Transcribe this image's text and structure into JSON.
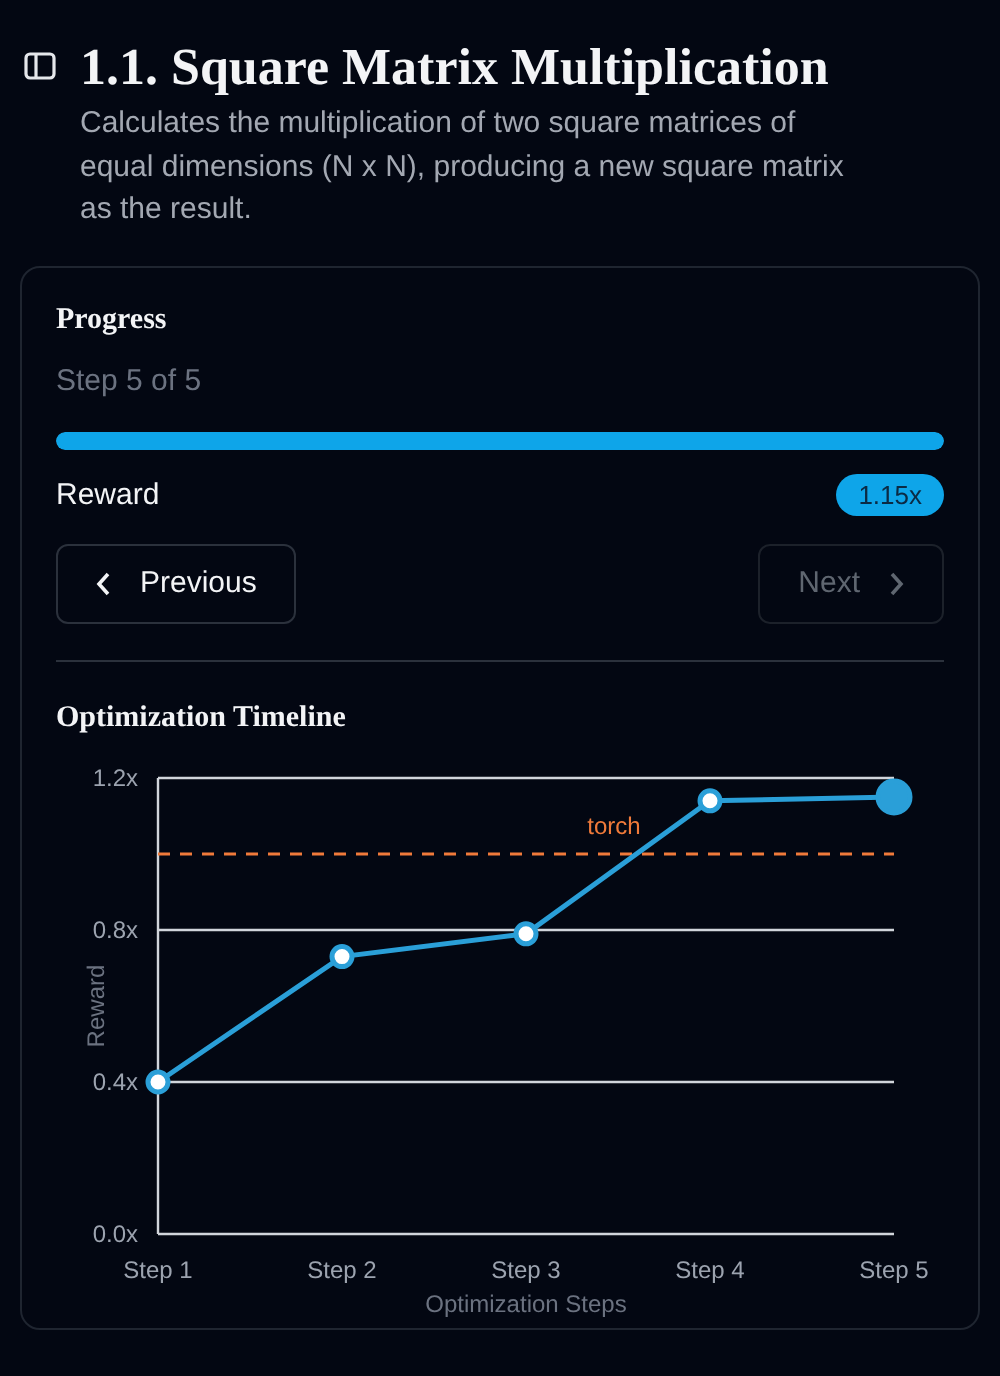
{
  "header": {
    "title": "1.1. Square Matrix Multiplication",
    "description": "Calculates the multiplication of two square matrices of equal dimensions (N x N), producing a new square matrix as the result."
  },
  "progress": {
    "title": "Progress",
    "step_text": "Step 5 of 5",
    "level": 1.0,
    "reward_label": "Reward",
    "reward_badge": "1.15x"
  },
  "buttons": [
    {
      "label": "Previous",
      "kind": "prev",
      "disabled": false
    },
    {
      "label": "Next",
      "kind": "next",
      "disabled": true
    }
  ],
  "timeline": {
    "title": "Optimization Timeline",
    "chart_data": {
      "type": "line",
      "xlabel": "Optimization Steps",
      "ylabel": "Reward",
      "categories": [
        "Step 1",
        "Step 2",
        "Step 3",
        "Step 4",
        "Step 5"
      ],
      "ylim": [
        0,
        1.2
      ],
      "yticks": [
        {
          "value": 0,
          "label": "0.0x"
        },
        {
          "value": 0.4,
          "label": "0.4x"
        },
        {
          "value": 0.8,
          "label": "0.8x"
        },
        {
          "value": 1.2,
          "label": "1.2x"
        }
      ],
      "series": [
        {
          "color": "#2a9fd8",
          "marker": "o",
          "values": [
            0.4,
            0.73,
            0.79,
            1.14,
            1.15
          ]
        }
      ],
      "ref_lines": [
        {
          "axis": "y",
          "value": 1.0,
          "label": "torch",
          "color": "#f07a3a"
        }
      ]
    }
  }
}
